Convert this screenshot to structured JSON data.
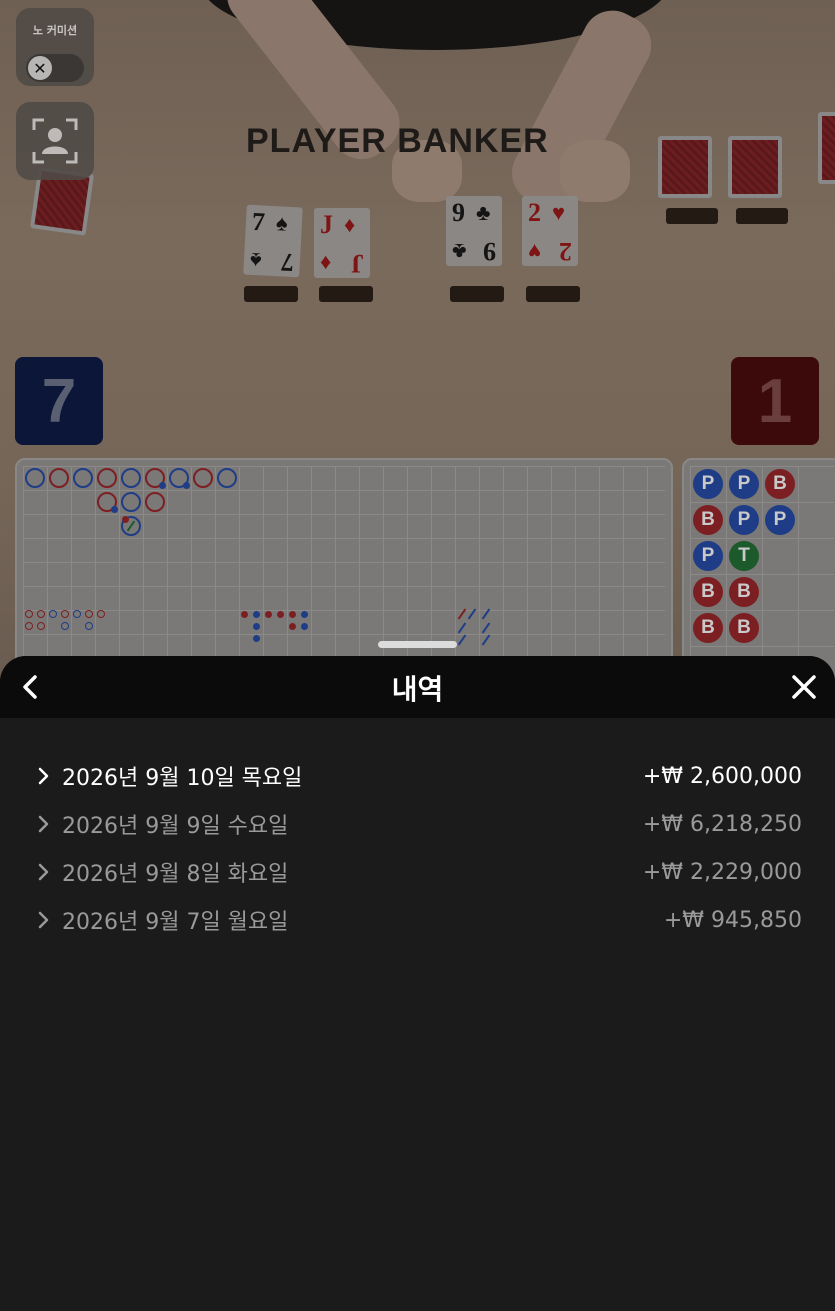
{
  "game": {
    "no_commission_label": "노 커미션",
    "table_label": "PLAYER BANKER",
    "player_score": "7",
    "banker_score": "1",
    "player_cards": [
      {
        "rank": "7",
        "suit": "♠",
        "color": "black"
      },
      {
        "rank": "J",
        "suit": "♦",
        "color": "red"
      }
    ],
    "banker_cards": [
      {
        "rank": "9",
        "suit": "♣",
        "color": "black"
      },
      {
        "rank": "2",
        "suit": "♥",
        "color": "red"
      }
    ],
    "bead_road": [
      [
        "P",
        "P",
        "B"
      ],
      [
        "B",
        "P",
        "P"
      ],
      [
        "P",
        "T",
        ""
      ],
      [
        "B",
        "B",
        ""
      ],
      [
        "B",
        "B",
        ""
      ]
    ],
    "colors": {
      "player": "#1e3d86",
      "banker": "#7c1f22",
      "tie": "#1c5a2b"
    }
  },
  "sheet": {
    "title": "내역",
    "back_icon": "chevron-left-icon",
    "close_icon": "close-icon",
    "rows": [
      {
        "date": "2026년 9월 10일 목요일",
        "amount": "+₩ 2,600,000",
        "active": true
      },
      {
        "date": "2026년 9월 9일 수요일",
        "amount": "+₩ 6,218,250",
        "active": false
      },
      {
        "date": "2026년 9월 8일 화요일",
        "amount": "+₩ 2,229,000",
        "active": false
      },
      {
        "date": "2026년 9월 7일 월요일",
        "amount": "+₩ 945,850",
        "active": false
      }
    ]
  }
}
